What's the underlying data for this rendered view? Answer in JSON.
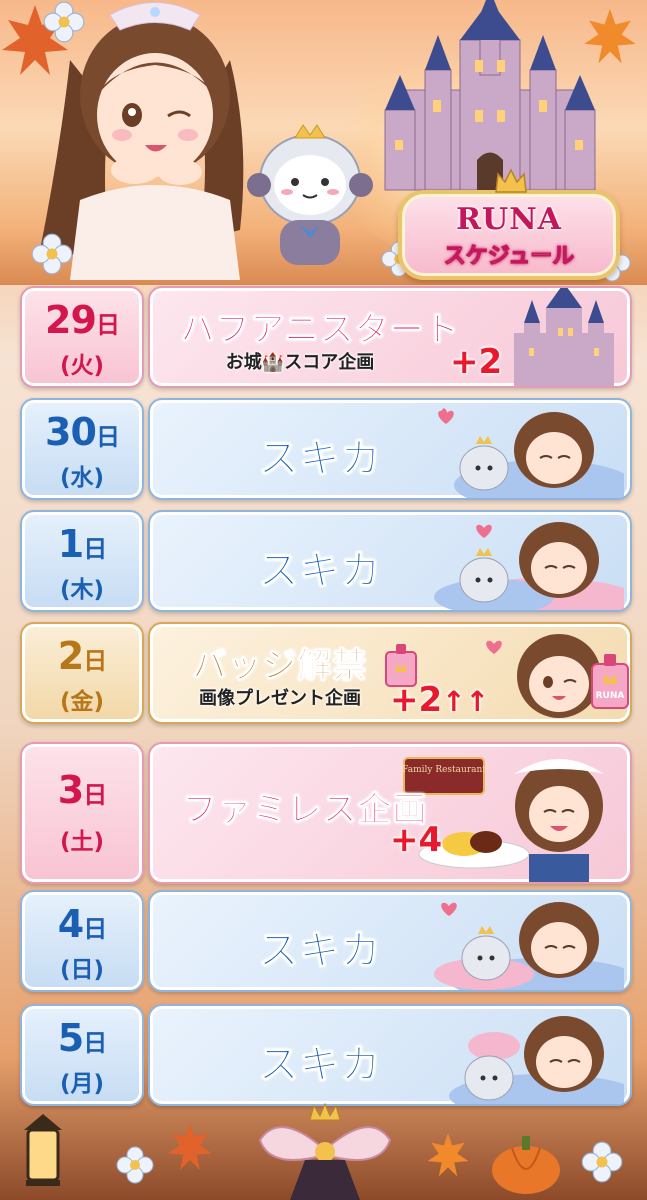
{
  "title": {
    "name": "RUNA",
    "subtitle": "スケジュール"
  },
  "schedule": [
    {
      "date": "29",
      "date_unit": "日",
      "weekday": "(火)",
      "title": "ハフアニスタート",
      "subtitle": "お城🏰スコア企画",
      "bonus": "+2",
      "theme": "pink"
    },
    {
      "date": "30",
      "date_unit": "日",
      "weekday": "(水)",
      "title": "スキカ",
      "theme": "blue"
    },
    {
      "date": "1",
      "date_unit": "日",
      "weekday": "(木)",
      "title": "スキカ",
      "theme": "blue"
    },
    {
      "date": "2",
      "date_unit": "日",
      "weekday": "(金)",
      "title": "バッジ解禁",
      "subtitle": "画像プレゼント企画",
      "bonus": "+2",
      "bonus_arrows": "↑↑",
      "badge_text": "RUNA",
      "theme": "gold"
    },
    {
      "date": "3",
      "date_unit": "日",
      "weekday": "(土)",
      "title": "ファミレス企画",
      "bonus": "+4",
      "sign_text": "Family Restaurant",
      "theme": "pink"
    },
    {
      "date": "4",
      "date_unit": "日",
      "weekday": "(日)",
      "title": "スキカ",
      "theme": "blue"
    },
    {
      "date": "5",
      "date_unit": "日",
      "weekday": "(月)",
      "title": "スキカ",
      "theme": "blue"
    }
  ],
  "icons": [
    "castle-icon",
    "crown-icon",
    "heart-icon",
    "badge-icon",
    "maple-leaf-icon",
    "flower-icon",
    "pumpkin-icon",
    "lantern-icon",
    "ribbon-icon"
  ],
  "colors": {
    "pink": "#d3174d",
    "blue": "#1b5fb4",
    "gold": "#b8761a",
    "bonus_red": "#e8192c"
  }
}
